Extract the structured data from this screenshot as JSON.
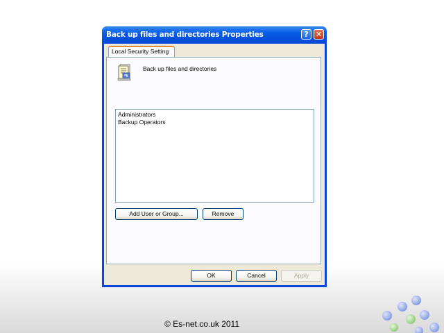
{
  "window": {
    "title": "Back up files and directories Properties",
    "help_glyph": "?",
    "close_glyph": "✕"
  },
  "tabs": [
    {
      "label": "Local Security Setting",
      "selected": true
    }
  ],
  "policy": {
    "name": "Back up files and directories",
    "icon": "policy-document-icon"
  },
  "members": [
    "Administrators",
    "Backup Operators"
  ],
  "buttons": {
    "add": "Add User or Group...",
    "remove": "Remove",
    "ok": "OK",
    "cancel": "Cancel",
    "apply": "Apply"
  },
  "footer": {
    "copyright": "© Es-net.co.uk 2011"
  },
  "colors": {
    "titlebar": "#0350dc",
    "dialog_face": "#ece9d8",
    "tab_accent": "#e68b2c",
    "logo_blue": "#8fa6e8",
    "logo_green": "#9fd08a"
  }
}
